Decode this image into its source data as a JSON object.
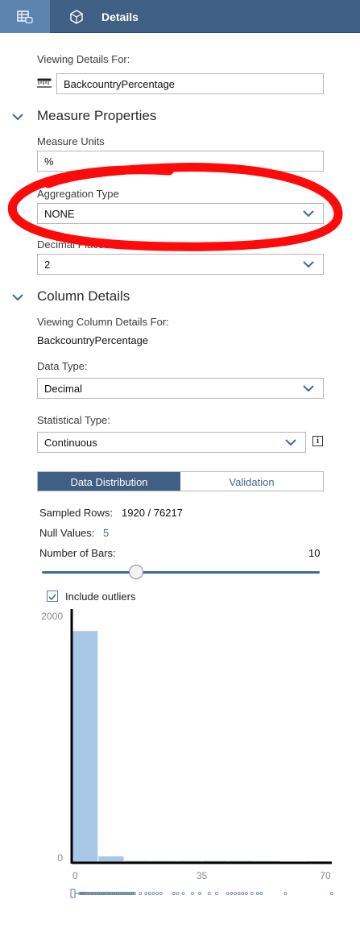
{
  "header": {
    "title": "Details"
  },
  "viewing": {
    "label": "Viewing Details For:",
    "value": "BackcountryPercentage"
  },
  "measure": {
    "heading": "Measure Properties",
    "units_label": "Measure Units",
    "units_value": "%",
    "aggregation_label": "Aggregation Type",
    "aggregation_value": "NONE",
    "decimal_label": "Decimal Places",
    "decimal_value": "2"
  },
  "column": {
    "heading": "Column Details",
    "viewing_label": "Viewing Column Details For:",
    "viewing_value": "BackcountryPercentage",
    "datatype_label": "Data Type:",
    "datatype_value": "Decimal",
    "stattype_label": "Statistical Type:",
    "stattype_value": "Continuous"
  },
  "tabs": {
    "active": "Data Distribution",
    "inactive": "Validation"
  },
  "stats": {
    "sampled_label": "Sampled Rows:",
    "sampled_value": "1920 / 76217",
    "null_label": "Null Values:",
    "null_value": "5",
    "bars_label": "Number of Bars:",
    "bars_value": "10"
  },
  "outliers": {
    "label": "Include outliers",
    "checked": true
  },
  "colors": {
    "accent": "#3f5f84",
    "bar": "#a9c8e8",
    "annotation": "#ff0000"
  },
  "chart_data": {
    "type": "bar",
    "x_ticks": [
      "0",
      "35",
      "70"
    ],
    "y_ticks": [
      "2000",
      "0"
    ],
    "ylim": [
      0,
      2000
    ],
    "bins": [
      {
        "start": 0,
        "end": 7,
        "value": 1850
      },
      {
        "start": 7,
        "end": 14,
        "value": 45
      },
      {
        "start": 14,
        "end": 21,
        "value": 10
      },
      {
        "start": 21,
        "end": 28,
        "value": 10
      },
      {
        "start": 28,
        "end": 35,
        "value": 10
      },
      {
        "start": 35,
        "end": 42,
        "value": 10
      },
      {
        "start": 42,
        "end": 49,
        "value": 10
      },
      {
        "start": 49,
        "end": 56,
        "value": 8
      },
      {
        "start": 56,
        "end": 63,
        "value": 0
      },
      {
        "start": 63,
        "end": 70,
        "value": 5
      }
    ],
    "xlim": [
      0,
      70
    ]
  }
}
